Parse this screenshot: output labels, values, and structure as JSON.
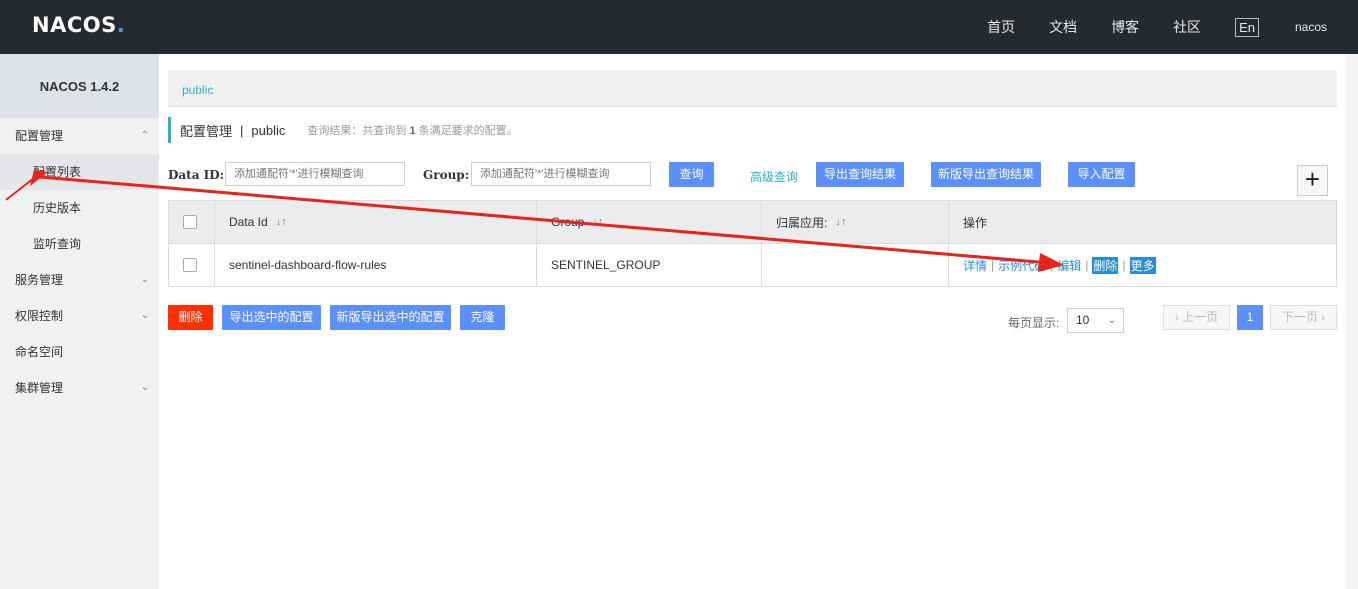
{
  "header": {
    "logo_text": "NACOS",
    "logo_dot": ".",
    "nav": [
      "首页",
      "文档",
      "博客",
      "社区"
    ],
    "lang": "En",
    "user": "nacos"
  },
  "sidebar": {
    "version": "NACOS 1.4.2",
    "items": [
      {
        "label": "配置管理",
        "chevron": "^"
      },
      {
        "label": "配置列表"
      },
      {
        "label": "历史版本"
      },
      {
        "label": "监听查询"
      },
      {
        "label": "服务管理",
        "chevron": "v"
      },
      {
        "label": "权限控制",
        "chevron": "v"
      },
      {
        "label": "命名空间"
      },
      {
        "label": "集群管理",
        "chevron": "v"
      }
    ]
  },
  "namespace": {
    "current": "public"
  },
  "title": {
    "main": "配置管理",
    "sep": "|",
    "ns": "public",
    "info_pre": "查询结果：共查询到",
    "info_count": "1",
    "info_post": "条满足要求的配置。"
  },
  "filters": {
    "dataid_label": "Data ID:",
    "dataid_placeholder": "添加通配符'*'进行模糊查询",
    "group_label": "Group:",
    "group_placeholder": "添加通配符'*'进行模糊查询",
    "search": "查询",
    "advanced": "高级查询",
    "export": "导出查询结果",
    "export_new": "新版导出查询结果",
    "import": "导入配置",
    "add": "+"
  },
  "table": {
    "headers": [
      "Data Id",
      "Group",
      "归属应用:",
      "操作"
    ],
    "rows": [
      {
        "data_id": "sentinel-dashboard-flow-rules",
        "group": "SENTINEL_GROUP",
        "app": "",
        "ops": [
          "详情",
          "示例代码",
          "编辑",
          "删除",
          "更多"
        ]
      }
    ]
  },
  "bottom": {
    "delete": "删除",
    "export_sel": "导出选中的配置",
    "export_sel_new": "新版导出选中的配置",
    "clone": "克隆",
    "page_size_label": "每页显示:",
    "page_size": "10",
    "prev": "上一页",
    "page": "1",
    "next": "下一页"
  },
  "colors": {
    "accent": "#5b8ff9",
    "teal": "#2bb2c5",
    "danger": "#ff3000",
    "annotation": "#e8231c"
  }
}
